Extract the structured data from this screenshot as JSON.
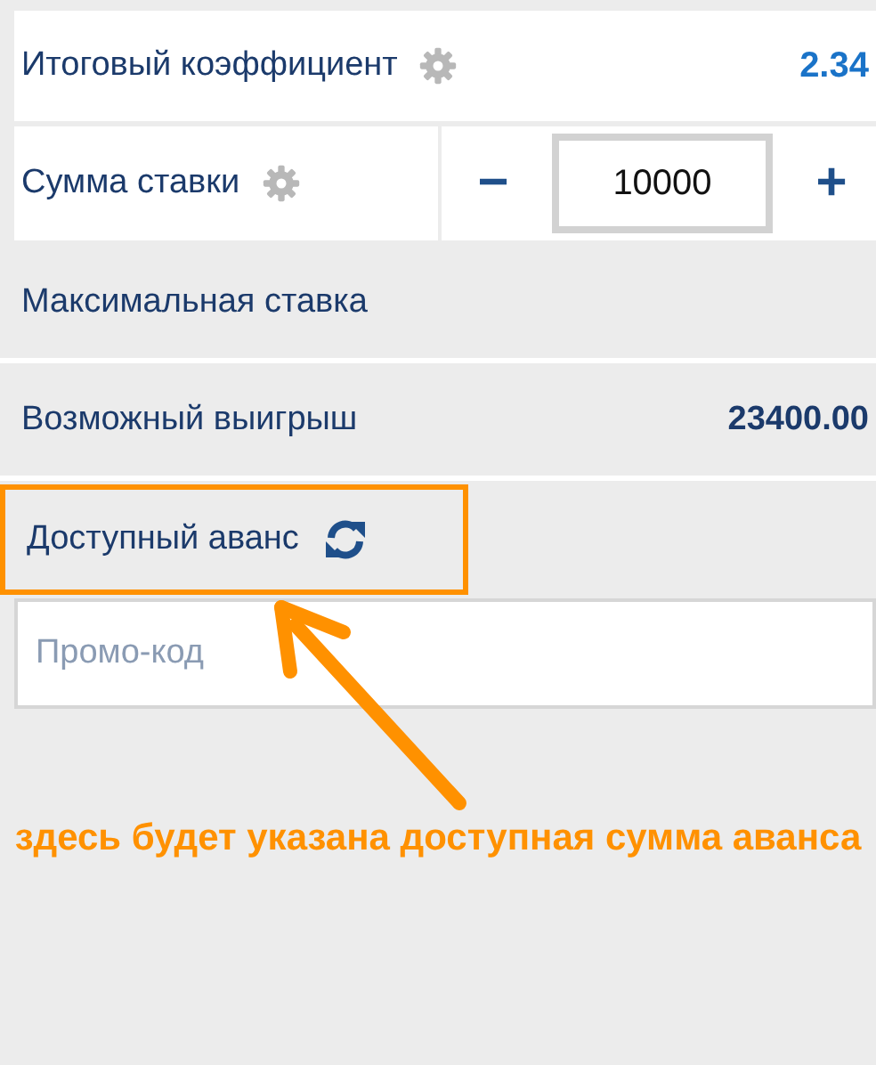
{
  "rows": [
    {
      "kind": "odds",
      "label": "Итоговый коэффициент",
      "value": "2.34"
    },
    {
      "kind": "stake",
      "label": "Сумма ставки",
      "minus": "−",
      "amount": "10000",
      "plus": "+"
    },
    {
      "kind": "plain",
      "label": "Максимальная ставка"
    },
    {
      "kind": "plain",
      "label": "Возможный выигрыш",
      "value": "23400.00"
    },
    {
      "kind": "advance",
      "label": "Доступный аванс",
      "highlighted": true
    }
  ],
  "promo": {
    "placeholder": "Промо-код"
  },
  "annotation": {
    "text": "здесь будет указана доступная сумма аванса"
  }
}
